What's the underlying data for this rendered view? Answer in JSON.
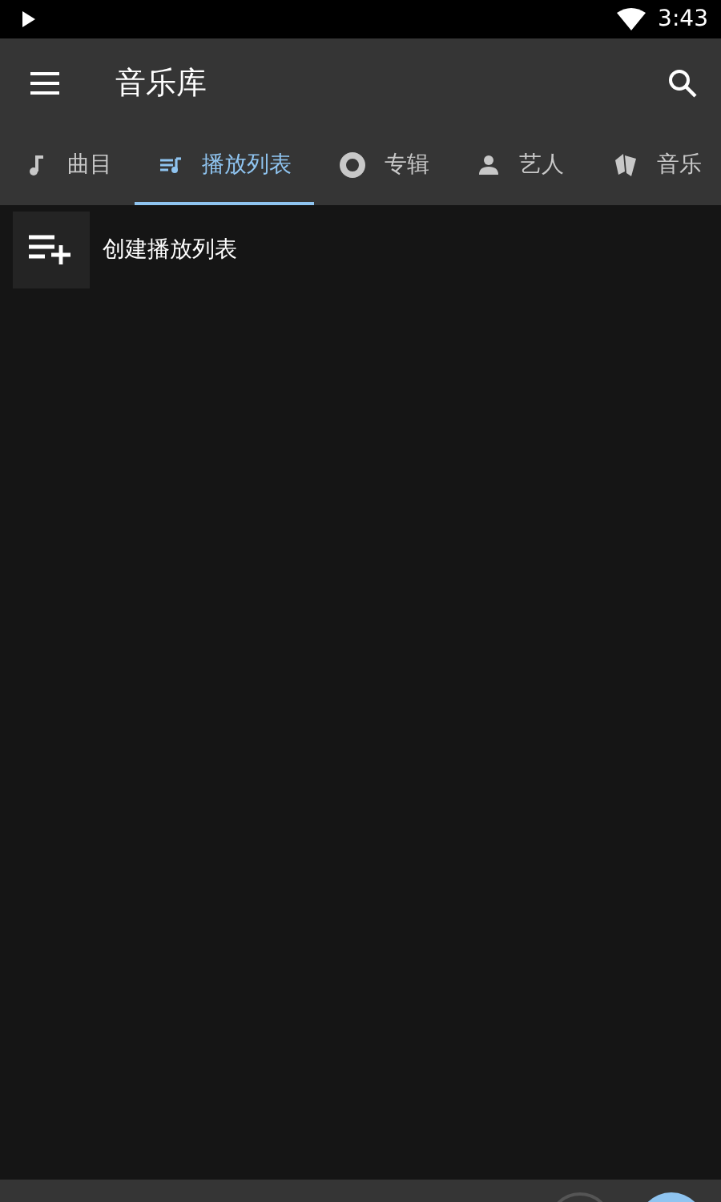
{
  "status_bar": {
    "time": "3:43"
  },
  "toolbar": {
    "title": "音乐库"
  },
  "tabs": [
    {
      "label": "曲目",
      "kind": "note",
      "selected": false
    },
    {
      "label": "播放列表",
      "kind": "playlist",
      "selected": true
    },
    {
      "label": "专辑",
      "kind": "disc",
      "selected": false
    },
    {
      "label": "艺人",
      "kind": "person",
      "selected": false
    },
    {
      "label": "音乐",
      "kind": "cards",
      "selected": false
    }
  ],
  "items": [
    {
      "label": "创建播放列表"
    }
  ]
}
